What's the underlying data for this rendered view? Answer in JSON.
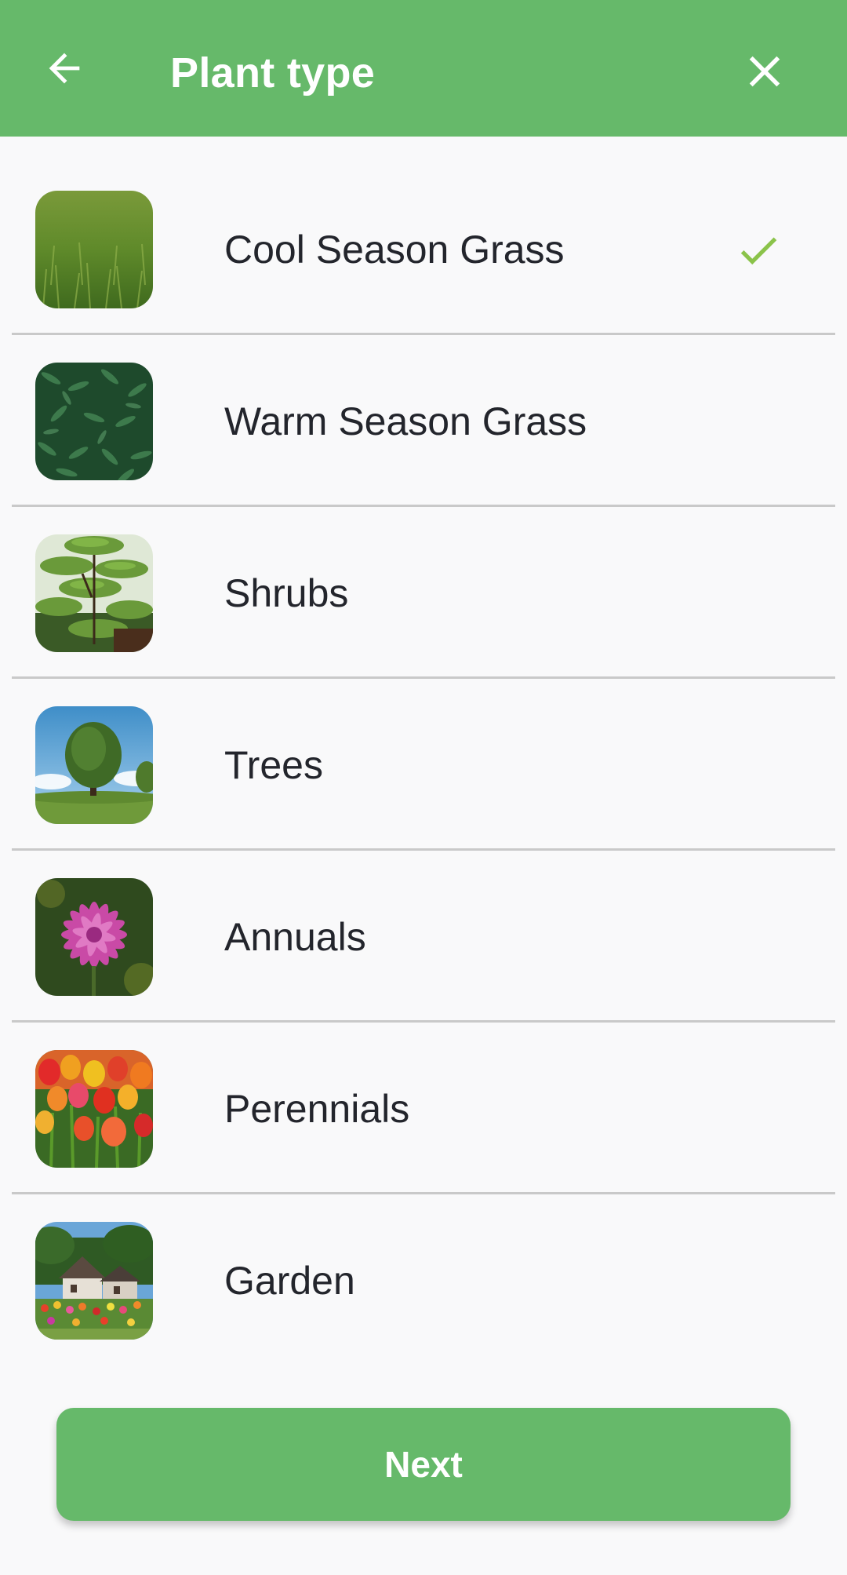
{
  "header": {
    "title": "Plant type",
    "back_icon": "arrow-left-icon",
    "close_icon": "close-icon"
  },
  "items": [
    {
      "label": "Cool Season Grass",
      "image": "cool-season-grass-photo",
      "selected": true
    },
    {
      "label": "Warm Season Grass",
      "image": "warm-season-grass-photo",
      "selected": false
    },
    {
      "label": "Shrubs",
      "image": "shrubs-photo",
      "selected": false
    },
    {
      "label": "Trees",
      "image": "trees-photo",
      "selected": false
    },
    {
      "label": "Annuals",
      "image": "annuals-photo",
      "selected": false
    },
    {
      "label": "Perennials",
      "image": "perennials-photo",
      "selected": false
    },
    {
      "label": "Garden",
      "image": "garden-photo",
      "selected": false
    }
  ],
  "next_button": {
    "label": "Next"
  },
  "colors": {
    "primary": "#66b96a",
    "check": "#8bc34a",
    "text": "#23252c",
    "divider": "#c9c9c9",
    "background": "#f9f9fa"
  }
}
